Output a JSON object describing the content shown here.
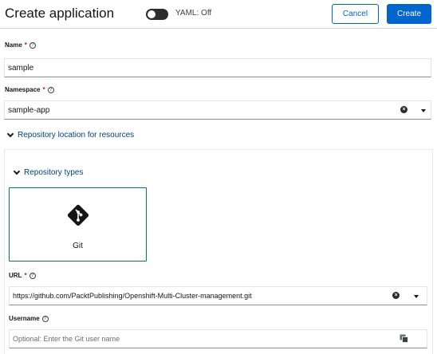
{
  "header": {
    "title": "Create application",
    "yaml_label": "YAML: Off",
    "cancel_label": "Cancel",
    "create_label": "Create"
  },
  "form": {
    "name": {
      "label": "Name",
      "required_marker": "*",
      "value": "sample"
    },
    "namespace": {
      "label": "Namespace",
      "required_marker": "*",
      "value": "sample-app"
    },
    "repository_location": {
      "label": "Repository location for resources"
    },
    "repository_types": {
      "label": "Repository types",
      "options": [
        {
          "label": "Git",
          "selected": true,
          "icon": "git-icon"
        }
      ]
    },
    "url": {
      "label": "URL",
      "required_marker": "*",
      "value": "https://github.com/PacktPublishing/Openshift-Multi-Cluster-management.git"
    },
    "username": {
      "label": "Username",
      "placeholder": "Optional: Enter the Git user name"
    }
  },
  "colors": {
    "primary": "#0066cc",
    "required": "#c9190b",
    "link": "#004080",
    "toggle_off": "#2b2b2b"
  }
}
